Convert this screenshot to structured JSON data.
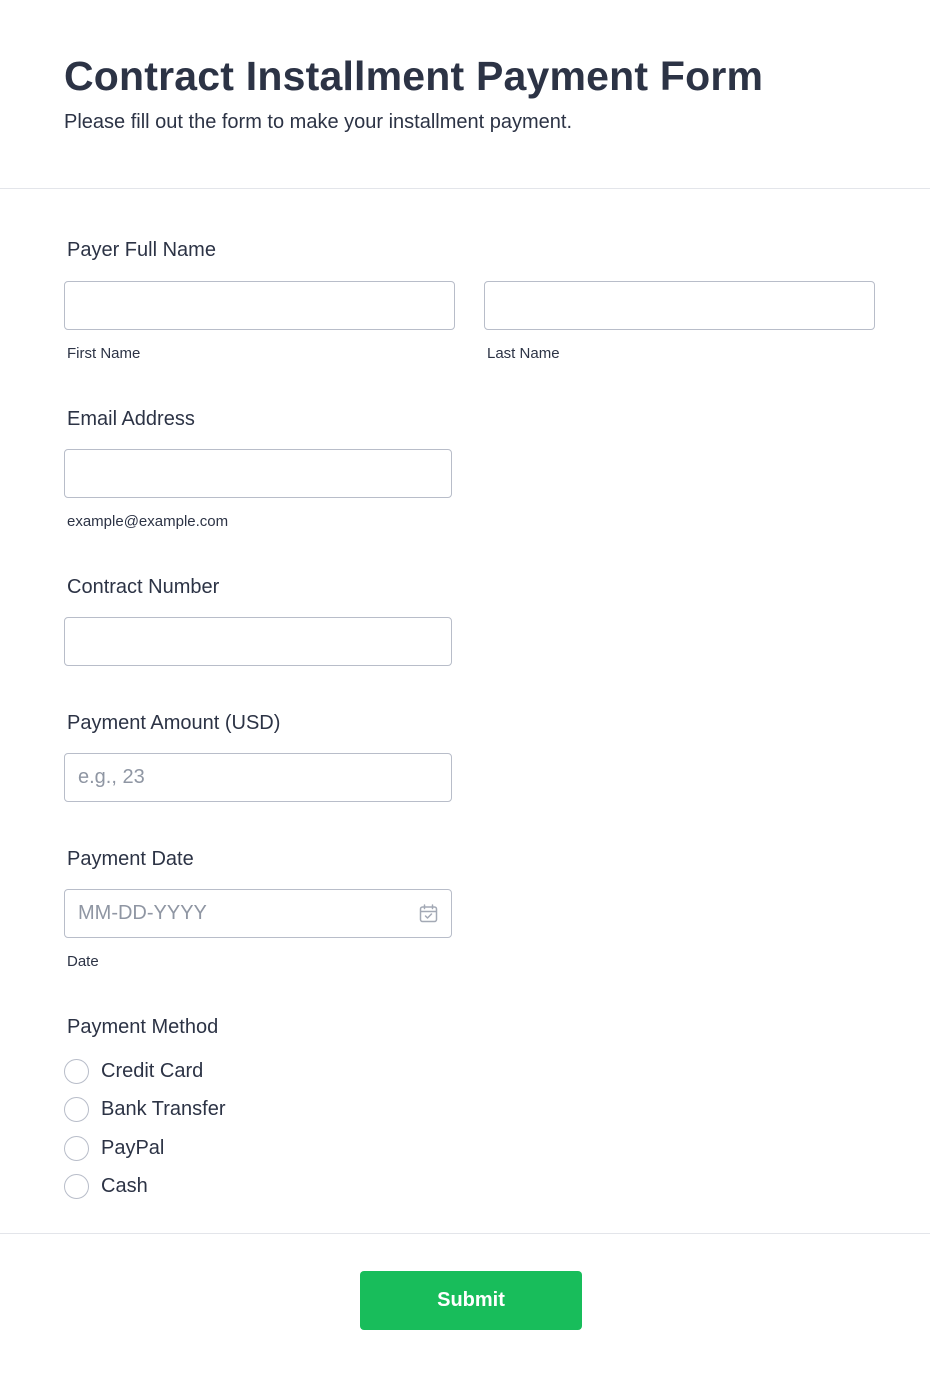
{
  "header": {
    "title": "Contract Installment Payment Form",
    "subtitle": "Please fill out the form to make your installment payment."
  },
  "fields": {
    "payer_name": {
      "label": "Payer Full Name",
      "first_sublabel": "First Name",
      "last_sublabel": "Last Name",
      "first_value": "",
      "last_value": ""
    },
    "email": {
      "label": "Email Address",
      "sublabel": "example@example.com",
      "value": ""
    },
    "contract_number": {
      "label": "Contract Number",
      "value": ""
    },
    "payment_amount": {
      "label": "Payment Amount (USD)",
      "placeholder": "e.g., 23",
      "value": ""
    },
    "payment_date": {
      "label": "Payment Date",
      "placeholder": "MM-DD-YYYY",
      "sublabel": "Date",
      "icon": "calendar-icon",
      "value": ""
    },
    "payment_method": {
      "label": "Payment Method",
      "options": [
        {
          "label": "Credit Card",
          "checked": false
        },
        {
          "label": "Bank Transfer",
          "checked": false
        },
        {
          "label": "PayPal",
          "checked": false
        },
        {
          "label": "Cash",
          "checked": false
        }
      ]
    }
  },
  "submit": {
    "label": "Submit"
  },
  "colors": {
    "accent": "#18bd5b",
    "text": "#2c3345",
    "border": "#b8bdc9",
    "placeholder": "#8f96a3",
    "divider": "#e3e5ea"
  }
}
